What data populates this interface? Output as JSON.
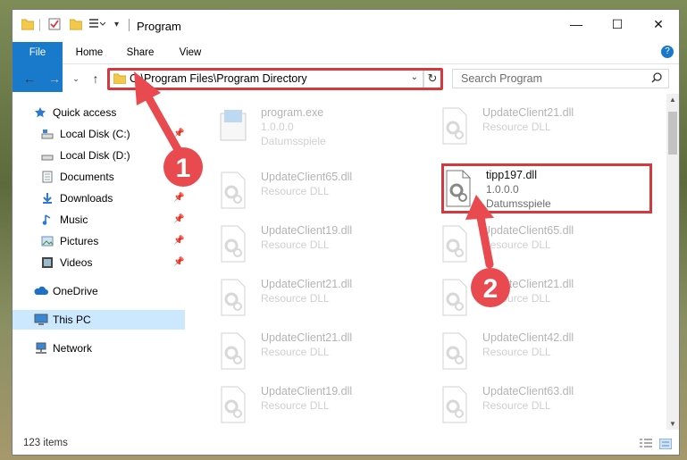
{
  "window": {
    "title": "Program"
  },
  "ribbon": {
    "tabs": [
      {
        "label": "File"
      },
      {
        "label": "Home"
      },
      {
        "label": "Share"
      },
      {
        "label": "View"
      }
    ]
  },
  "nav": {
    "address": "C:\\Program Files\\Program Directory",
    "search_placeholder": "Search Program"
  },
  "sidebar": {
    "items": [
      {
        "label": "Quick access",
        "icon": "star-icon"
      },
      {
        "label": "Local Disk (C:)",
        "icon": "drive-icon",
        "pinned": true
      },
      {
        "label": "Local Disk (D:)",
        "icon": "drive-icon"
      },
      {
        "label": "Documents",
        "icon": "documents-icon",
        "pinned": true
      },
      {
        "label": "Downloads",
        "icon": "download-icon",
        "pinned": true
      },
      {
        "label": "Music",
        "icon": "music-icon",
        "pinned": true
      },
      {
        "label": "Pictures",
        "icon": "pictures-icon",
        "pinned": true
      },
      {
        "label": "Videos",
        "icon": "videos-icon",
        "pinned": true
      },
      {
        "label": "OneDrive",
        "icon": "cloud-icon"
      },
      {
        "label": "This PC",
        "icon": "computer-icon",
        "selected": true
      },
      {
        "label": "Network",
        "icon": "network-icon"
      }
    ]
  },
  "files": [
    {
      "name": "program.exe",
      "line2": "1.0.0.0",
      "line3": "Datumsspiele"
    },
    {
      "name": "UpdateClient21.dll",
      "line2": "Resource DLL"
    },
    {
      "name": "UpdateClient65.dll",
      "line2": "Resource DLL"
    },
    {
      "name": "tipp197.dll",
      "line2": "1.0.0.0",
      "line3": "Datumsspiele"
    },
    {
      "name": "UpdateClient19.dll",
      "line2": "Resource DLL"
    },
    {
      "name": "UpdateClient65.dll",
      "line2": "Resource DLL"
    },
    {
      "name": "UpdateClient21.dll",
      "line2": "Resource DLL"
    },
    {
      "name": "UpdateClient21.dll",
      "line2": "Resource DLL"
    },
    {
      "name": "UpdateClient21.dll",
      "line2": "Resource DLL"
    },
    {
      "name": "UpdateClient42.dll",
      "line2": "Resource DLL"
    },
    {
      "name": "UpdateClient19.dll",
      "line2": "Resource DLL"
    },
    {
      "name": "UpdateClient63.dll",
      "line2": "Resource DLL"
    }
  ],
  "status": {
    "items_count": "123 items"
  },
  "annotations": {
    "step1": "1",
    "step2": "2",
    "highlight_color": "#d5393d"
  }
}
